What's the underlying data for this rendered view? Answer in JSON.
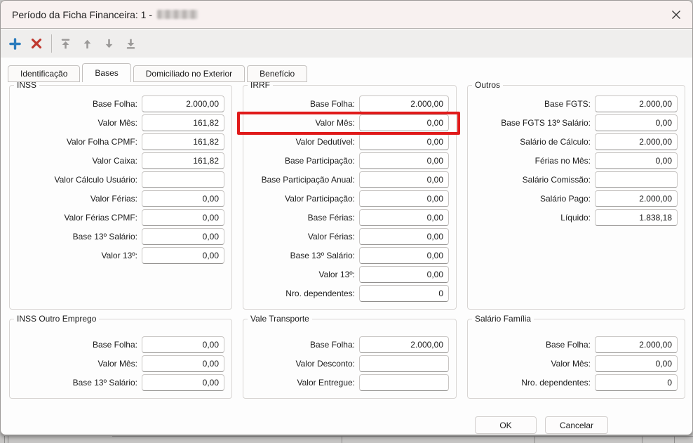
{
  "window": {
    "title": "Período da Ficha Financeira: 1 -",
    "title_redacted": true
  },
  "toolbar": {
    "buttons": [
      "add",
      "delete",
      "move-first",
      "move-up",
      "move-down",
      "move-last"
    ]
  },
  "tabs": [
    {
      "label": "Identificação",
      "active": false
    },
    {
      "label": "Bases",
      "active": true
    },
    {
      "label": "Domiciliado no Exterior",
      "active": false
    },
    {
      "label": "Benefício",
      "active": false
    }
  ],
  "groups": [
    {
      "title": "INSS",
      "fields": [
        {
          "label": "Base Folha:",
          "value": "2.000,00"
        },
        {
          "label": "Valor Mês:",
          "value": "161,82"
        },
        {
          "label": "Valor Folha CPMF:",
          "value": "161,82"
        },
        {
          "label": "Valor Caixa:",
          "value": "161,82"
        },
        {
          "label": "Valor Cálculo Usuário:",
          "value": ""
        },
        {
          "label": "Valor Férias:",
          "value": "0,00"
        },
        {
          "label": "Valor Férias CPMF:",
          "value": "0,00"
        },
        {
          "label": "Base 13º Salário:",
          "value": "0,00"
        },
        {
          "label": "Valor 13º:",
          "value": "0,00"
        }
      ]
    },
    {
      "title": "IRRF",
      "fields": [
        {
          "label": "Base Folha:",
          "value": "2.000,00"
        },
        {
          "label": "Valor Mês:",
          "value": "0,00",
          "highlight": true
        },
        {
          "label": "Valor Dedutível:",
          "value": "0,00"
        },
        {
          "label": "Base Participação:",
          "value": "0,00"
        },
        {
          "label": "Base Participação Anual:",
          "value": "0,00"
        },
        {
          "label": "Valor Participação:",
          "value": "0,00"
        },
        {
          "label": "Base Férias:",
          "value": "0,00"
        },
        {
          "label": "Valor Férias:",
          "value": "0,00"
        },
        {
          "label": "Base 13º Salário:",
          "value": "0,00"
        },
        {
          "label": "Valor 13º:",
          "value": "0,00"
        },
        {
          "label": "Nro. dependentes:",
          "value": "0"
        }
      ]
    },
    {
      "title": "Outros",
      "fields": [
        {
          "label": "Base FGTS:",
          "value": "2.000,00"
        },
        {
          "label": "Base FGTS 13º Salário:",
          "value": "0,00"
        },
        {
          "label": "Salário de Cálculo:",
          "value": "2.000,00"
        },
        {
          "label": "Férias no Mês:",
          "value": "0,00"
        },
        {
          "label": "Salário Comissão:",
          "value": ""
        },
        {
          "label": "Salário Pago:",
          "value": "2.000,00"
        },
        {
          "label": "Líquido:",
          "value": "1.838,18"
        }
      ]
    },
    {
      "title": "INSS Outro Emprego",
      "fields": [
        {
          "label": "Base Folha:",
          "value": "0,00"
        },
        {
          "label": "Valor Mês:",
          "value": "0,00"
        },
        {
          "label": "Base 13º Salário:",
          "value": "0,00"
        }
      ]
    },
    {
      "title": "Vale Transporte",
      "fields": [
        {
          "label": "Base Folha:",
          "value": "2.000,00"
        },
        {
          "label": "Valor Desconto:",
          "value": ""
        },
        {
          "label": "Valor Entregue:",
          "value": ""
        }
      ]
    },
    {
      "title": "Salário Família",
      "fields": [
        {
          "label": "Base Folha:",
          "value": "2.000,00"
        },
        {
          "label": "Valor Mês:",
          "value": "0,00"
        },
        {
          "label": "Nro. dependentes:",
          "value": "0"
        }
      ]
    }
  ],
  "footer": {
    "ok_label": "OK",
    "cancel_label": "Cancelar"
  },
  "colors": {
    "highlight_red": "#e01a1a",
    "add_blue": "#2b7cbd",
    "delete_red": "#c0392f",
    "arrow_gray": "#9b9998",
    "titlebar_bg": "#f8f1f0"
  }
}
